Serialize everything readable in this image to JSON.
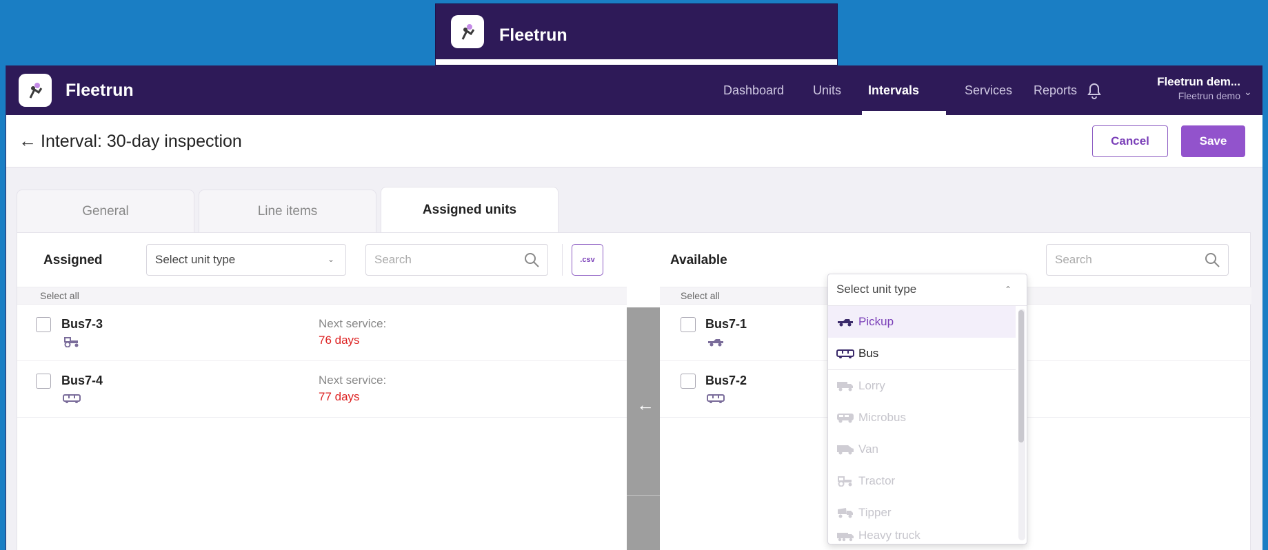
{
  "app": {
    "name": "Fleetrun"
  },
  "ghost_window": {
    "brand": "Fleetrun"
  },
  "nav": {
    "items": [
      {
        "label": "Dashboard"
      },
      {
        "label": "Units"
      },
      {
        "label": "Intervals",
        "active": true
      },
      {
        "label": "Services"
      },
      {
        "label": "Reports"
      }
    ],
    "bell_icon": "bell-icon"
  },
  "user": {
    "name": "Fleetrun dem...",
    "account": "Fleetrun demo"
  },
  "header": {
    "back_icon": "arrow-left-icon",
    "title": "Interval: 30-day inspection",
    "cancel_label": "Cancel",
    "save_label": "Save"
  },
  "tabs": [
    {
      "label": "General"
    },
    {
      "label": "Line items"
    },
    {
      "label": "Assigned units",
      "active": true
    }
  ],
  "assigned": {
    "label": "Assigned",
    "unit_type_placeholder": "Select unit type",
    "search_placeholder": "Search",
    "csv_label": ".csv",
    "select_all": "Select all",
    "units": [
      {
        "name": "Bus7-3",
        "icon": "tractor-icon",
        "next_label": "Next service:",
        "next_value": "76 days"
      },
      {
        "name": "Bus7-4",
        "icon": "bus-icon",
        "next_label": "Next service:",
        "next_value": "77 days"
      }
    ]
  },
  "transfer": {
    "arrow_icon": "arrow-left-icon"
  },
  "available": {
    "label": "Available",
    "unit_type_placeholder": "Select unit type",
    "search_placeholder": "Search",
    "select_all": "Select all",
    "units": [
      {
        "name": "Bus7-1",
        "icon": "pickup-icon"
      },
      {
        "name": "Bus7-2",
        "icon": "bus-icon"
      }
    ]
  },
  "dropdown": {
    "options": [
      {
        "label": "Pickup",
        "icon": "pickup-icon",
        "state": "highlighted"
      },
      {
        "label": "Bus",
        "icon": "bus-icon",
        "state": "enabled"
      },
      {
        "label": "Lorry",
        "icon": "lorry-icon",
        "state": "disabled"
      },
      {
        "label": "Microbus",
        "icon": "microbus-icon",
        "state": "disabled"
      },
      {
        "label": "Van",
        "icon": "van-icon",
        "state": "disabled"
      },
      {
        "label": "Tractor",
        "icon": "tractor-icon",
        "state": "disabled"
      },
      {
        "label": "Tipper",
        "icon": "tipper-icon",
        "state": "disabled"
      },
      {
        "label": "Heavy truck",
        "icon": "heavy-truck-icon",
        "state": "disabled"
      }
    ]
  },
  "colors": {
    "topbar": "#2e1a58",
    "accent": "#9253cc",
    "danger": "#dd2222",
    "desktop": "#1a7ec4"
  }
}
